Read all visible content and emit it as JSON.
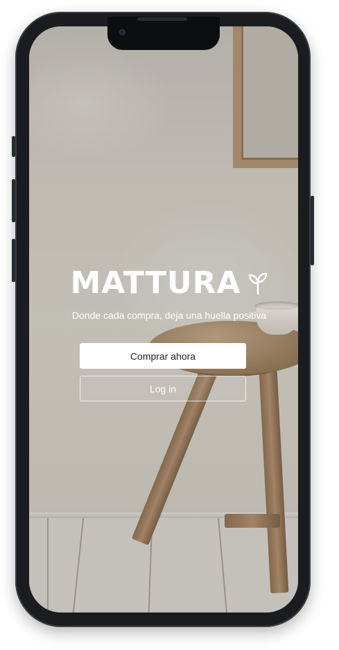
{
  "brand": {
    "name": "MATTURA",
    "logo_icon": "leaf-sprout-icon"
  },
  "tagline": "Donde cada compra, deja una huella positiva",
  "actions": {
    "primary_label": "Comprar ahora",
    "secondary_label": "Log in"
  },
  "colors": {
    "accent": "#ffffff",
    "primary_button_text": "#222222",
    "device_frame": "#1b1c20"
  }
}
